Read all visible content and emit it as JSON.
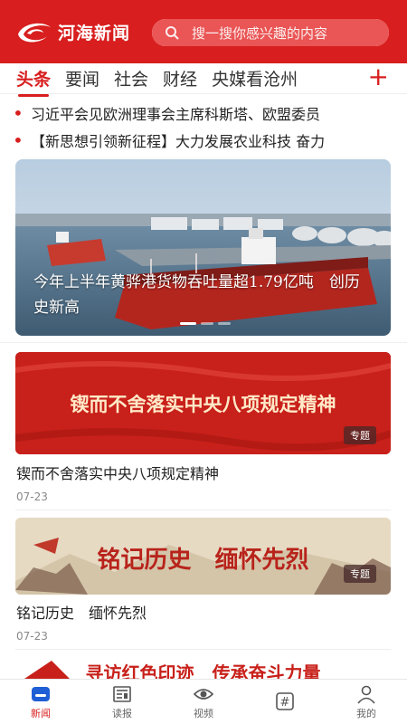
{
  "header": {
    "app_name": "河海新闻",
    "search_placeholder": "搜一搜你感兴趣的内容",
    "brand_color": "#d81e1e"
  },
  "tabs": [
    {
      "label": "头条",
      "active": true
    },
    {
      "label": "要闻"
    },
    {
      "label": "社会"
    },
    {
      "label": "财经"
    },
    {
      "label": "央媒看沧州"
    }
  ],
  "tab_add_icon": "plus-icon",
  "headlines": [
    "习近平会见欧洲理事会主席科斯塔、欧盟委员",
    "【新思想引领新征程】大力发展农业科技 奋力"
  ],
  "carousel": {
    "caption": "今年上半年黄骅港货物吞吐量超1.79亿吨　创历史新高",
    "slide_count": 3,
    "active_slide": 1
  },
  "topics": [
    {
      "banner_text": "锲而不舍落实中央八项规定精神",
      "tag": "专题",
      "title": "锲而不舍落实中央八项规定精神",
      "date": "07-23"
    },
    {
      "banner_text": "铭记历史　缅怀先烈",
      "tag": "专题",
      "title": "铭记历史　缅怀先烈",
      "date": "07-23"
    }
  ],
  "partial_banner_text": "寻访红色印迹　传承奋斗力量",
  "bottom_nav": [
    {
      "label": "新闻",
      "icon": "news-icon",
      "active": true
    },
    {
      "label": "读报",
      "icon": "newspaper-icon"
    },
    {
      "label": "视频",
      "icon": "eye-icon"
    },
    {
      "label": "",
      "icon": "hashtag-icon"
    },
    {
      "label": "我的",
      "icon": "person-icon"
    }
  ]
}
